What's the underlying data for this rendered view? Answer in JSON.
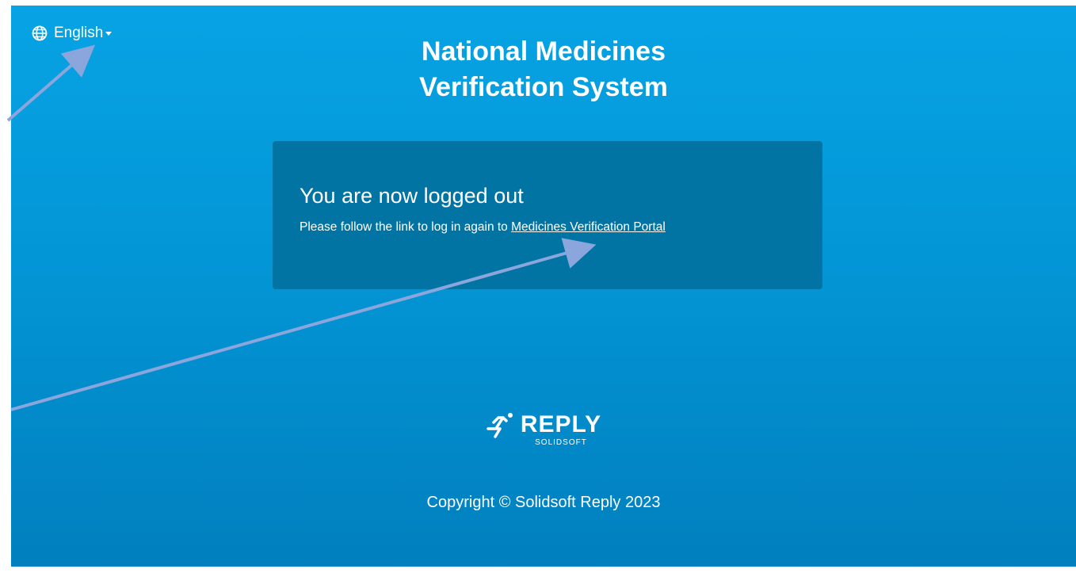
{
  "language": {
    "label": "English",
    "icon": "globe-icon"
  },
  "header": {
    "title_line1": "National Medicines",
    "title_line2": "Verification System"
  },
  "panel": {
    "heading": "You are now logged out",
    "text": "Please follow the link to log in again to ",
    "link_label": "Medicines Verification Portal"
  },
  "footer": {
    "brand": "REPLY",
    "brand_sub": "SOLIDSOFT",
    "copyright": "Copyright © Solidsoft Reply 2023"
  },
  "colors": {
    "background_top": "#07a3e4",
    "background_bottom": "#017fbe",
    "panel": "#0274a3",
    "annotation_arrow": "#8aa6dc"
  }
}
